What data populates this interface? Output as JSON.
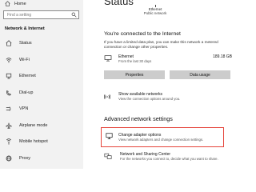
{
  "sidebar": {
    "home_label": "Home",
    "search_placeholder": "Find a setting",
    "section_title": "Network & Internet",
    "items": [
      {
        "label": "Status",
        "icon": "home-icon"
      },
      {
        "label": "Wi-Fi",
        "icon": "wifi-icon"
      },
      {
        "label": "Ethernet",
        "icon": "ethernet-icon"
      },
      {
        "label": "Dial-up",
        "icon": "dialup-icon"
      },
      {
        "label": "VPN",
        "icon": "vpn-icon"
      },
      {
        "label": "Airplane mode",
        "icon": "airplane-icon"
      },
      {
        "label": "Mobile hotspot",
        "icon": "hotspot-icon"
      },
      {
        "label": "Proxy",
        "icon": "globe-icon"
      }
    ]
  },
  "main": {
    "title": "Status",
    "network_label": "Ethernet",
    "network_type": "Public network",
    "connected_title": "You're connected to the Internet",
    "connected_desc": "If you have a limited data plan, you can make this network a metered connection or change other properties.",
    "adapter": {
      "name": "Ethernet",
      "sub": "From the last 30 days",
      "usage": "189.18 GB"
    },
    "properties_button": "Properties",
    "data_usage_button": "Data usage",
    "show_networks": {
      "title": "Show available networks",
      "sub": "View the connection options around you."
    },
    "advanced_title": "Advanced network settings",
    "change_adapter": {
      "title": "Change adapter options",
      "sub": "View network adapters and change connection settings."
    },
    "sharing_center": {
      "title": "Network and Sharing Center",
      "sub": "For the networks you connect to, decide what you want to share."
    }
  },
  "colors": {
    "sidebar_bg": "#f2f2f2",
    "button_bg": "#cccccc",
    "highlight_border": "#e5443a"
  }
}
